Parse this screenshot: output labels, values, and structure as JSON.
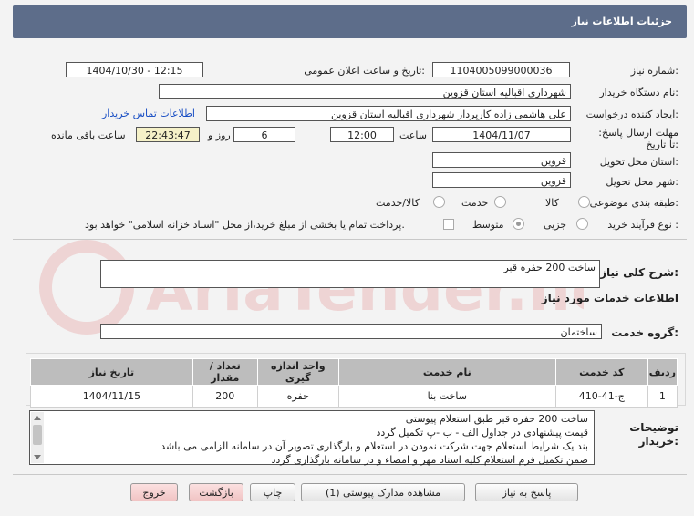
{
  "header": {
    "title": "جزئیات اطلاعات نیاز"
  },
  "fields": {
    "need_number_label": "شماره نیاز:",
    "need_number": "1104005099000036",
    "announce_label": "تاریخ و ساعت اعلان عمومی:",
    "announce_value": "1404/10/30 - 12:15",
    "buyer_org_label": "نام دستگاه خریدار:",
    "buyer_org": "شهرداری اقبالیه استان قزوین",
    "creator_label": "ایجاد کننده درخواست:",
    "creator": "علی هاشمی زاده کارپرداز شهرداری اقبالیه استان قزوین",
    "contact_link": "اطلاعات تماس خریدار",
    "deadline_label": "مهلت ارسال پاسخ: تا تاریخ:",
    "deadline_date": "1404/11/07",
    "time_label": "ساعت",
    "deadline_time": "12:00",
    "days_value": "6",
    "days_label": "روز و",
    "remaining_value": "22:43:47",
    "remaining_label": "ساعت باقی مانده",
    "province_label": "استان محل تحویل:",
    "province": "قزوین",
    "city_label": "شهر محل تحویل:",
    "city": "قزوین",
    "category_label": "طبقه بندی موضوعی:",
    "category_options": [
      "کالا",
      "خدمت",
      "کالا/خدمت"
    ],
    "process_label": "نوع فرآیند خرید :",
    "process_options": [
      "جزیی",
      "متوسط"
    ],
    "payment_note": "پرداخت تمام یا بخشی از مبلغ خرید،از محل \"اسناد خزانه اسلامی\" خواهد بود."
  },
  "summary": {
    "label": "شرح کلی نیاز:",
    "value": "ساخت 200 حفره قبر"
  },
  "services": {
    "title": "اطلاعات خدمات مورد نیاز",
    "group_label": "گروه خدمت:",
    "group_value": "ساختمان",
    "columns": [
      "ردیف",
      "کد خدمت",
      "نام خدمت",
      "واحد اندازه گیری",
      "تعداد / مقدار",
      "تاریخ نیاز"
    ],
    "rows": [
      [
        "1",
        "ج-41-410",
        "ساخت بنا",
        "حفره",
        "200",
        "1404/11/15"
      ]
    ]
  },
  "buyer_notes": {
    "label": "توضیحات خریدار:",
    "lines": [
      "ساخت 200 حفره قبر طبق استعلام پیوستی",
      "قیمت پیشنهادی در جداول الف - ب -پ تکمیل گردد",
      "بند یک شرایط استعلام جهت شرکت نمودن در استعلام و بارگذاری تصویر آن در سامانه الزامی می باشد",
      "ضمن تکمیل فرم استعلام کلیه اسناد مهر و امضاء و در سامانه بارگذاری گردد"
    ]
  },
  "buttons": {
    "reply": "پاسخ به نیاز",
    "attachments": "مشاهده مدارک پیوستی (1)",
    "print": "چاپ",
    "back": "بازگشت",
    "exit": "خروج"
  },
  "watermark": "AriaTender.net",
  "colors": {
    "titlebar": "#5d6d8a",
    "link": "#1a4fc4",
    "highlight": "#f5f1c8"
  }
}
